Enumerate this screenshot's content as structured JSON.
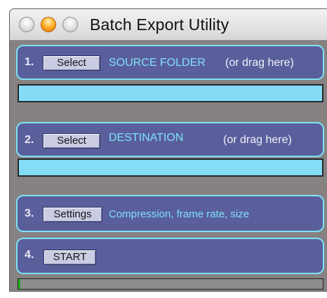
{
  "window": {
    "title": "Batch Export Utility"
  },
  "step1": {
    "number": "1.",
    "button": "Select",
    "label": "SOURCE FOLDER",
    "note": "(or drag here)",
    "path": ""
  },
  "step2": {
    "number": "2.",
    "button": "Select",
    "label": "DESTINATION",
    "note": "(or drag here)",
    "path": ""
  },
  "step3": {
    "number": "3.",
    "button": "Settings",
    "label": "Compression, frame rate, size"
  },
  "step4": {
    "number": "4.",
    "button": "START"
  },
  "progress": {
    "value": 0
  },
  "colors": {
    "panel": "#5a5f9c",
    "panel_border": "#7ee2f4",
    "field": "#84dcf6",
    "label": "#7fe0f6",
    "window_bg": "#868282",
    "progress_fill": "#1fb21f"
  }
}
